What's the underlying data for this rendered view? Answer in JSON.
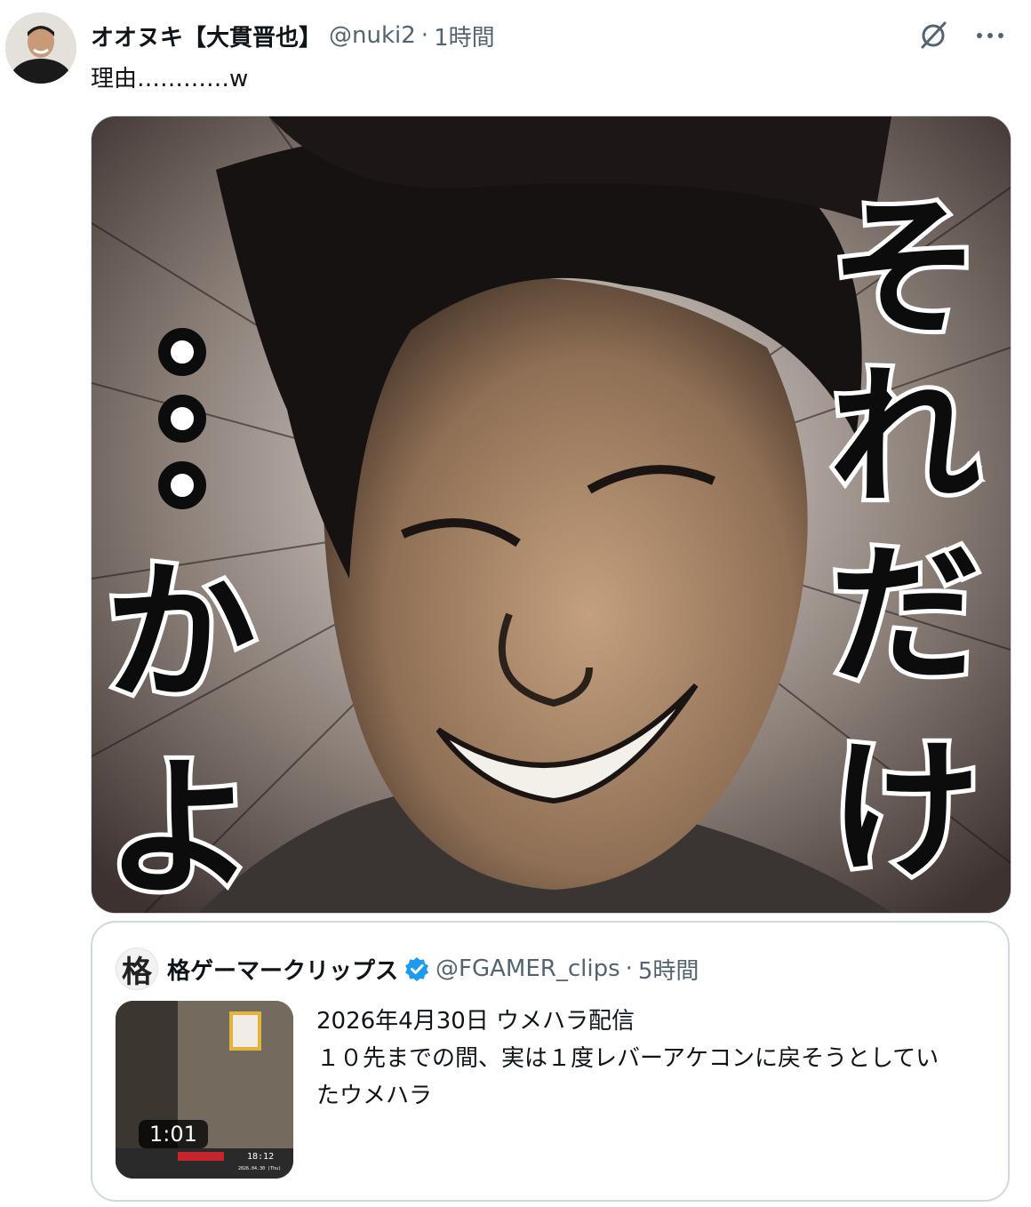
{
  "tweet": {
    "display_name": "オオヌキ【大貫晋也】",
    "handle": "@nuki2",
    "separator": "·",
    "time": "1時間",
    "text": "理由…………w",
    "image_caption_right": "それだけ",
    "image_caption_left": "かよ"
  },
  "actions": {
    "grok_icon": "grok-icon",
    "more_icon": "more-icon"
  },
  "quote": {
    "avatar_char": "格",
    "display_name": "格ゲーマークリップス",
    "handle": "@FGAMER_clips",
    "separator": "·",
    "time": "5時間",
    "text_line1": "2026年4月30日 ウメハラ配信",
    "text_line2": "１０先までの間、実は１度レバーアケコンに戻そうとしてい",
    "text_line3": "たウメハラ",
    "duration": "1:01",
    "thumb_clock": "18:12",
    "thumb_date": "2026.04.30 (Thu)"
  },
  "colors": {
    "text_primary": "#0f1419",
    "text_secondary": "#536471",
    "border": "#cfd9de",
    "verified_blue": "#1d9bf0"
  }
}
